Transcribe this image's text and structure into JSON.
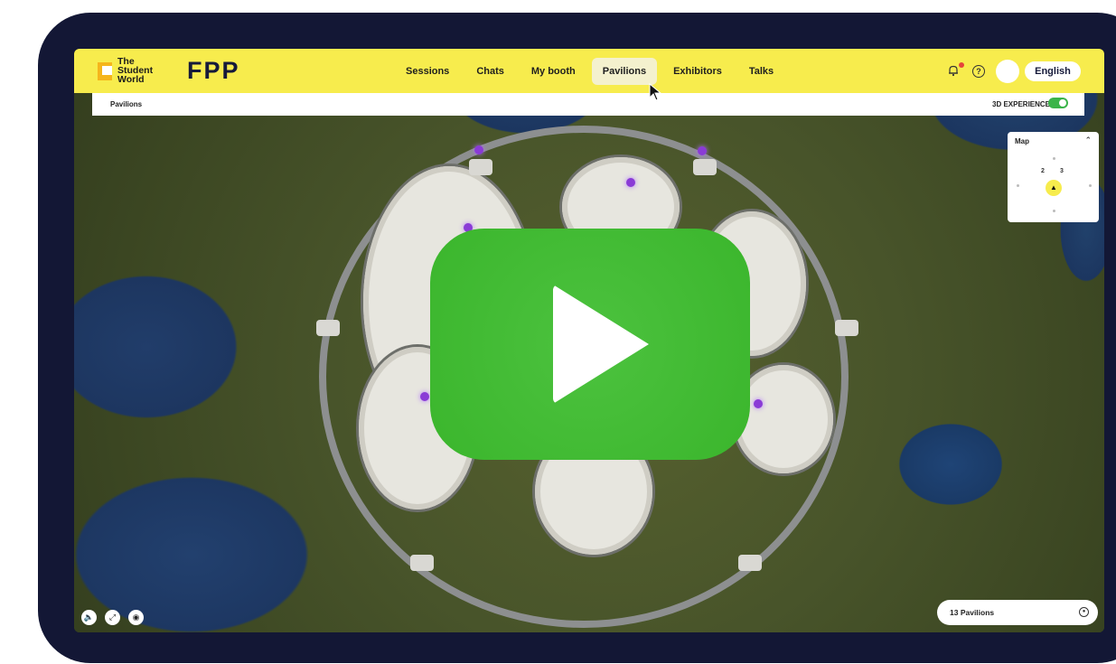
{
  "header": {
    "logo_lines": [
      "The",
      "Student",
      "World"
    ],
    "brand": "FPP",
    "nav": [
      {
        "label": "Sessions",
        "active": false
      },
      {
        "label": "Chats",
        "active": false
      },
      {
        "label": "My booth",
        "active": false
      },
      {
        "label": "Pavilions",
        "active": true
      },
      {
        "label": "Exhibitors",
        "active": false
      },
      {
        "label": "Talks",
        "active": false
      }
    ],
    "help_glyph": "?",
    "language": "English"
  },
  "subbar": {
    "breadcrumb": "Pavilions",
    "experience_label": "3D EXPERIENCE",
    "experience_on": true
  },
  "minimap": {
    "title": "Map",
    "markers": [
      "2",
      "3"
    ]
  },
  "footer": {
    "pavilion_count": "13 Pavilions"
  },
  "icons": [
    "bell-icon",
    "help-icon",
    "avatar",
    "collapse-chevron-icon",
    "sound-icon",
    "fullscreen-icon",
    "settings-icon",
    "location-arrow-icon",
    "play-icon",
    "cursor-pointer"
  ],
  "colors": {
    "brand_yellow": "#f7ec4d",
    "device_frame": "#131735",
    "play_green": "#3dbd2e",
    "toggle_green": "#3bb44a"
  }
}
